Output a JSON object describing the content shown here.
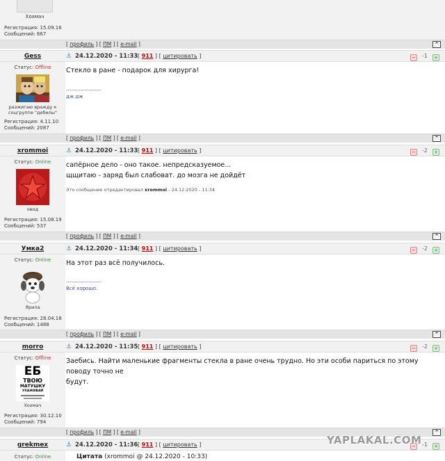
{
  "prev_user": {
    "name": "Хохмач",
    "reg_label": "Регистрация: 15.09.16",
    "posts_label": "Сообщений: 667"
  },
  "link_labels": {
    "profile": "профиль",
    "pm": "ПМ",
    "email": "e-mail",
    "quote": "цитировать",
    "up": "^"
  },
  "posts": [
    {
      "user": "Gess",
      "status_label": "Статус:",
      "status": "Offline",
      "avatar_caption": "разжигаю вражду к соцгруппе \"дебилы\"",
      "reg": "Регистрация: 4.11.10",
      "count": "Сообщений: 2087",
      "date": "24.12.2020 - 11:33",
      "num": "911",
      "rating": "-1",
      "text": [
        "Стекло в ране - подарок для хирурга!"
      ],
      "sig_line": "--------------------",
      "sig_text": "дж дж"
    },
    {
      "user": "xrommoi",
      "status_label": "Статус:",
      "status": "Online",
      "avatar_caption": "овод",
      "reg": "Регистрация: 15.08.19",
      "count": "Сообщений: 537",
      "date": "24.12.2020 - 11:33",
      "num": "911",
      "rating": "-2",
      "text": [
        "сапёрное дело - оно такое. непредсказуемое...",
        "щщитаю - заряд был слабоват. до мозга не дойдёт"
      ],
      "edited_prefix": "Это сообщение отредактировал",
      "edited_user": "xrommoi",
      "edited_date": "- 24.12.2020 - 11:34"
    },
    {
      "user": "Умка2",
      "status_label": "Статус:",
      "status": "Online",
      "avatar_caption": "Ярила",
      "reg": "Регистрация: 28.04.18",
      "count": "Сообщений: 1488",
      "date": "24.12.2020 - 11:34",
      "num": "911",
      "rating": "-2",
      "text": [
        "На этот раз всё получилось."
      ],
      "sig_line": "--------------------",
      "sig_text": "Всё хорошо."
    },
    {
      "user": "morro",
      "status_label": "Статус:",
      "status": "Offline",
      "avatar_caption": "Хохмач",
      "avatar_lines": [
        "ЕБ",
        "ТВОЮ",
        "МАТУШКУ",
        "УХАЖИВАЙ"
      ],
      "reg": "Регистрация: 30.12.10",
      "count": "Сообщений: 794",
      "date": "24.12.2020 - 11:35",
      "num": "911",
      "rating": "-2",
      "text": [
        "Заебись. Найти маленькие фрагменты стекла в ране очень трудно. Но эти особи париться по этому поводу точно не",
        "будут."
      ]
    },
    {
      "user": "grekmex",
      "status_label": "Статус:",
      "status": "Online",
      "date": "24.12.2020 - 11:36",
      "num": "911",
      "rating": "-1",
      "quote_label": "Цитата",
      "quote_src": "(xrommoi @ 24.12.2020 - 10:33)"
    }
  ],
  "watermark": "YAPLAKAL.COM",
  "colors": {
    "offline": "#dd2222",
    "online": "#2a9a2a",
    "number": "#cc0000"
  }
}
